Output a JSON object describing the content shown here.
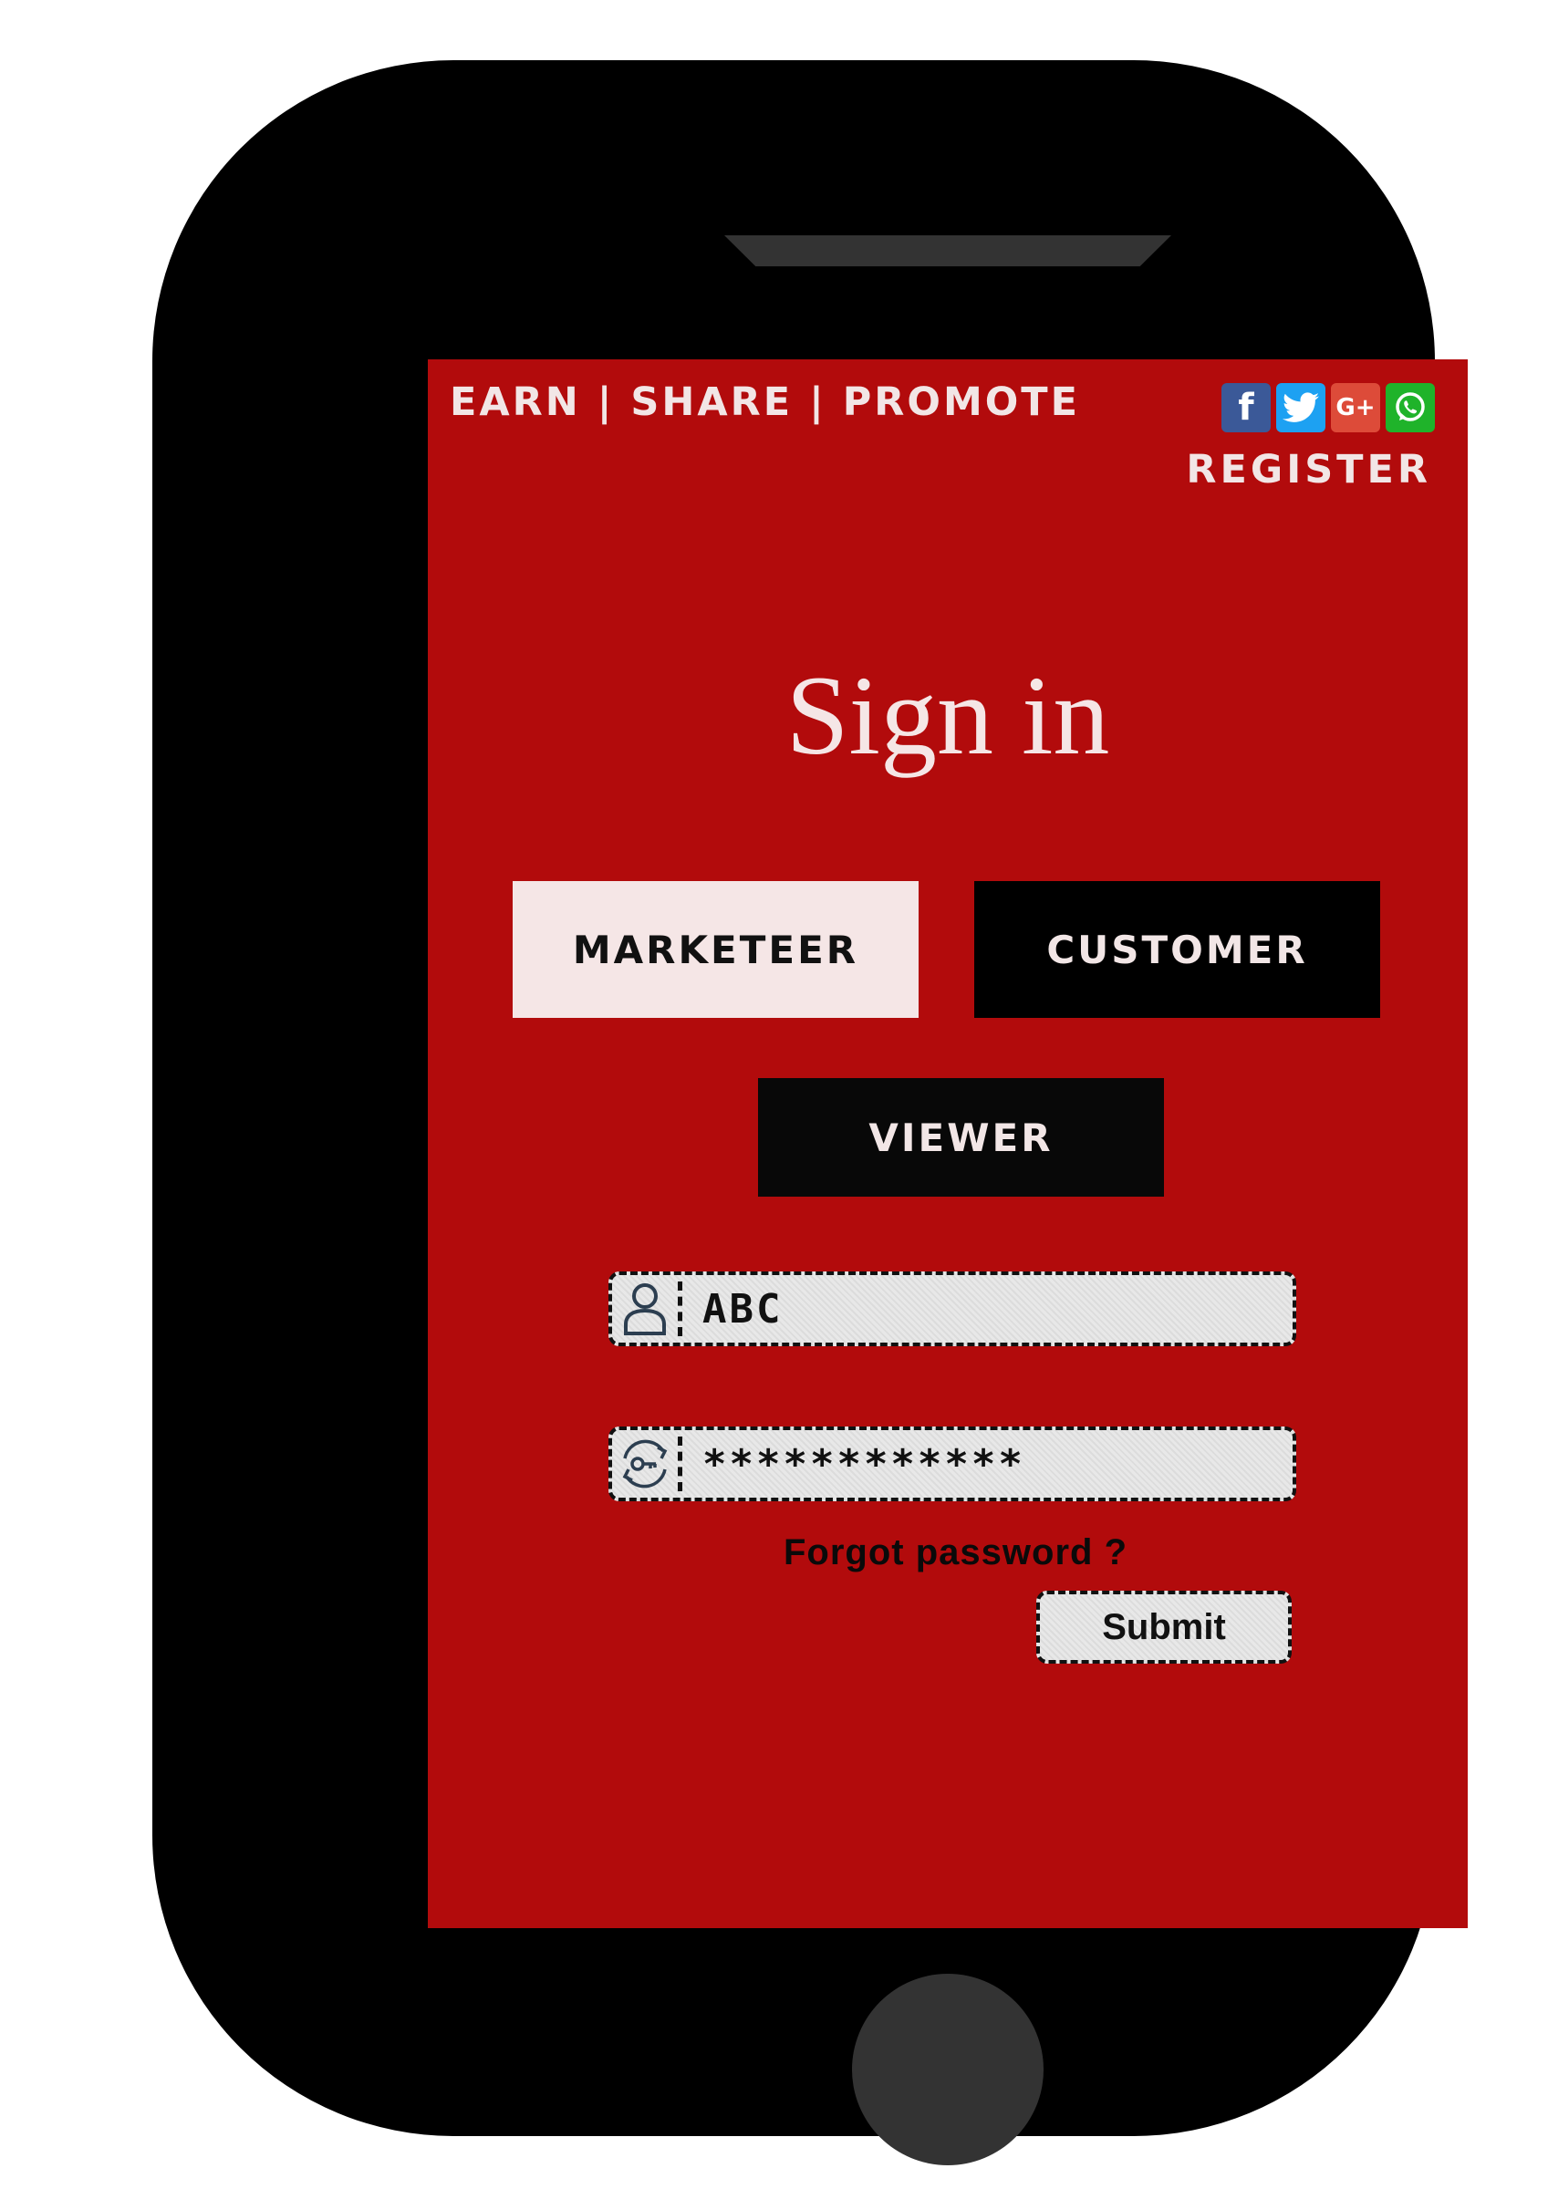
{
  "header": {
    "tagline": "EARN | SHARE | PROMOTE",
    "register_label": "REGISTER",
    "social_icons": [
      "facebook-icon",
      "twitter-icon",
      "google-plus-icon",
      "whatsapp-icon"
    ],
    "facebook_glyph": "f",
    "google_plus_glyph": "G+"
  },
  "main": {
    "title": "Sign in",
    "roles": {
      "marketeer": "MARKETEER",
      "customer": "CUSTOMER",
      "viewer": "VIEWER"
    },
    "selected_role": "MARKETEER",
    "username_value": "ABC",
    "password_value": "************",
    "forgot_label": "Forgot password ?",
    "submit_label": "Submit"
  },
  "colors": {
    "screen_bg": "#b20b0c",
    "phone_body": "#000000",
    "selected_role_bg": "#f5e6e6",
    "unselected_role_bg": "#000000"
  }
}
